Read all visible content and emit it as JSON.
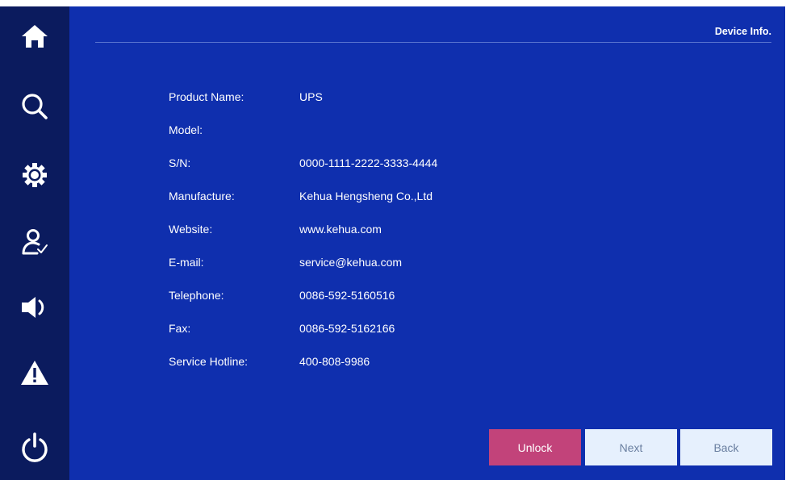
{
  "header": {
    "title": "Device Info."
  },
  "sidebar": {
    "items": [
      {
        "icon": "home-icon",
        "label": "Home"
      },
      {
        "icon": "search-icon",
        "label": "Search"
      },
      {
        "icon": "gear-icon",
        "label": "Settings"
      },
      {
        "icon": "user-check-icon",
        "label": "User"
      },
      {
        "icon": "speaker-icon",
        "label": "Sound"
      },
      {
        "icon": "warning-icon",
        "label": "Alarm"
      },
      {
        "icon": "power-icon",
        "label": "Power"
      }
    ]
  },
  "device_info": {
    "rows": [
      {
        "label": "Product Name:",
        "value": "UPS"
      },
      {
        "label": "Model:",
        "value": ""
      },
      {
        "label": "S/N:",
        "value": "0000-1111-2222-3333-4444"
      },
      {
        "label": "Manufacture:",
        "value": "Kehua Hengsheng Co.,Ltd"
      },
      {
        "label": "Website:",
        "value": "www.kehua.com"
      },
      {
        "label": "E-mail:",
        "value": "service@kehua.com"
      },
      {
        "label": "Telephone:",
        "value": "0086-592-5160516"
      },
      {
        "label": "Fax:",
        "value": "0086-592-5162166"
      },
      {
        "label": "Service Hotline:",
        "value": "400-808-9986"
      }
    ]
  },
  "buttons": {
    "unlock": "Unlock",
    "next": "Next",
    "back": "Back"
  },
  "colors": {
    "background": "#0f2fae",
    "sidebar": "#0b1b5e",
    "unlock_button": "#c2437a",
    "secondary_button": "#e6f0fd"
  }
}
